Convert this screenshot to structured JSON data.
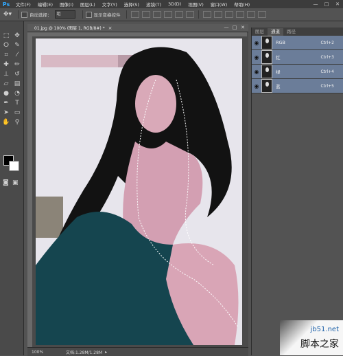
{
  "app": {
    "logo": "Ps"
  },
  "menu": [
    "文件(F)",
    "编辑(E)",
    "图像(I)",
    "图层(L)",
    "文字(Y)",
    "选择(S)",
    "滤镜(T)",
    "3D(D)",
    "视图(V)",
    "窗口(W)",
    "帮助(H)"
  ],
  "window_controls": {
    "minimize": "—",
    "maximize": "□",
    "close": "✕"
  },
  "options": {
    "auto_select_label": "自动选择：",
    "auto_select_value": "组",
    "show_transform_label": "显示变换控件"
  },
  "document": {
    "tab_title": "01.jpg @ 100% (图层 1, RGB/8#) *",
    "close": "×",
    "zoom": "100%",
    "doc_info": "文档:1.28M/1.28M"
  },
  "panel": {
    "tabs": [
      "图层",
      "通道",
      "路径"
    ],
    "active_tab": "通道",
    "channels": [
      {
        "name": "RGB",
        "shortcut": "Ctrl+2"
      },
      {
        "name": "红",
        "shortcut": "Ctrl+3"
      },
      {
        "name": "绿",
        "shortcut": "Ctrl+4"
      },
      {
        "name": "蓝",
        "shortcut": "Ctrl+5"
      }
    ]
  },
  "watermark": {
    "site": "jb51.net",
    "name": "脚本之家"
  },
  "colors": {
    "foreground": "#000000",
    "background": "#ffffff",
    "channel_highlight": "#6b7d99",
    "ps_blue": "#31a8ff"
  }
}
